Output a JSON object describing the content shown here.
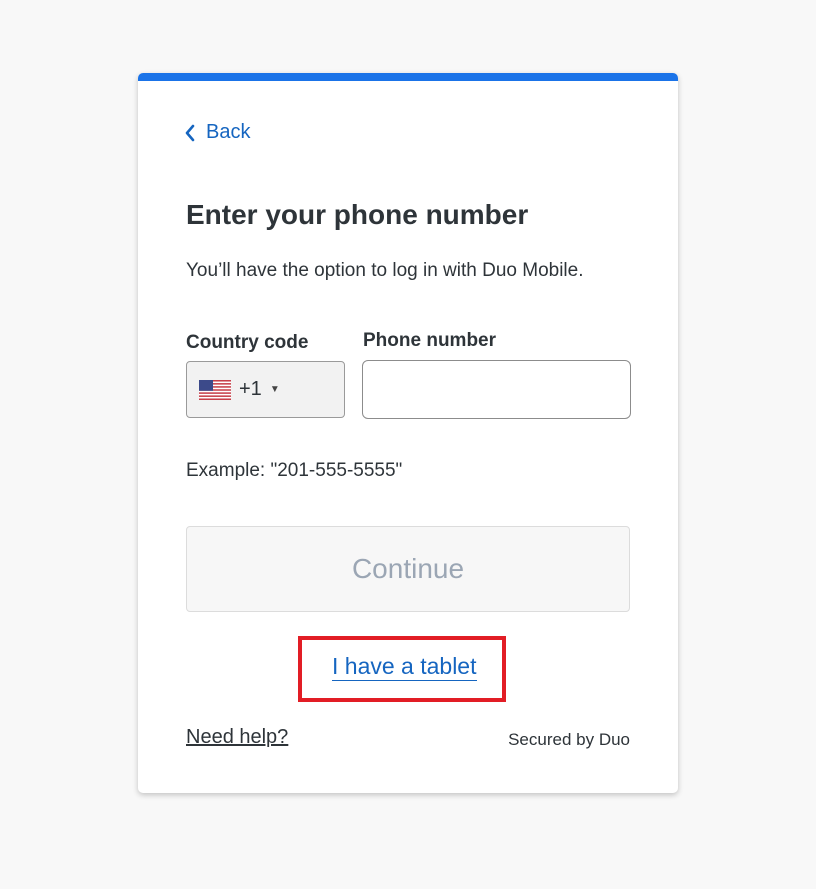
{
  "header": {
    "back_label": "Back",
    "accent_color": "#1a73e8"
  },
  "main": {
    "title": "Enter your phone number",
    "subtitle": "You’ll have the option to log in with Duo Mobile."
  },
  "form": {
    "country_code_label": "Country code",
    "country_code_value": "+1",
    "country_flag": "us-flag-icon",
    "phone_label": "Phone number",
    "phone_value": "",
    "example_text": "Example: \"201-555-5555\"",
    "continue_label": "Continue",
    "continue_enabled": false
  },
  "links": {
    "tablet_label": "I have a tablet",
    "help_label": "Need help?"
  },
  "footer": {
    "secured_text": "Secured by Duo"
  },
  "annotation": {
    "highlight_color": "#e21d25"
  }
}
